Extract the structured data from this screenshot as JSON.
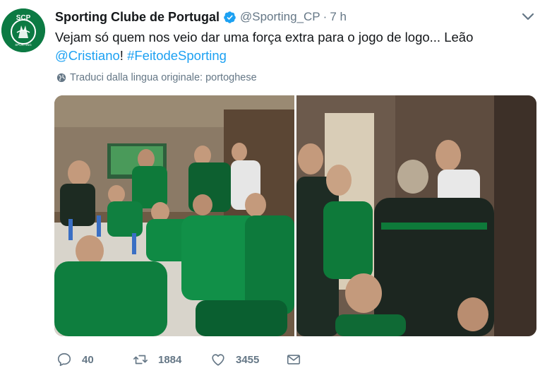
{
  "tweet": {
    "author": {
      "display_name": "Sporting Clube de Portugal",
      "handle": "@Sporting_CP",
      "verified": true,
      "avatar_text": "SCP",
      "avatar_subtext": "SPORTING"
    },
    "separator": "·",
    "time": "7 h",
    "text_before": "Vejam só quem nos veio dar uma força extra para o jogo de logo... Leão ",
    "mention": "@Cristiano",
    "text_middle": "! ",
    "hashtag": "#FeitodeSporting",
    "translate_label": "Traduci dalla lingua originale: portoghese",
    "media": [
      {
        "icon": "photo-team-dinner"
      },
      {
        "icon": "photo-cristiano-embrace"
      }
    ],
    "actions": {
      "reply_count": "40",
      "retweet_count": "1884",
      "like_count": "3455"
    }
  },
  "colors": {
    "link": "#1da1f2",
    "secondary": "#657786",
    "verified": "#1da1f2",
    "brand_green": "#0c7a43"
  },
  "icons": {
    "menu": "chevron-down-icon",
    "translate": "globe-icon",
    "reply": "reply-icon",
    "retweet": "retweet-icon",
    "like": "heart-icon",
    "dm": "envelope-icon"
  }
}
